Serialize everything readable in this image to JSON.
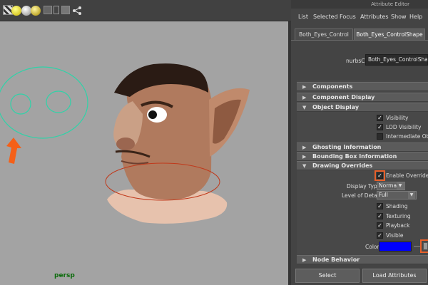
{
  "viewport": {
    "camera_label": "persp",
    "toolbar_icons": [
      "checker-icon",
      "light-yellow-icon",
      "light-gray-icon",
      "light-sphere-icon",
      "lights-icon",
      "isolate-icon",
      "cube-icon",
      "share-icon"
    ]
  },
  "attribute_editor": {
    "window_title": "Attribute Editor",
    "menu": [
      "List",
      "Selected",
      "Focus",
      "Attributes",
      "Show",
      "Help"
    ],
    "tabs": [
      "Both_Eyes_Control",
      "Both_Eyes_ControlShape"
    ],
    "active_tab": 1,
    "nurbs_label": "nurbsCurve:",
    "nurbs_value": "Both_Eyes_ControlShape",
    "sections": {
      "components": "Components",
      "component_display": "Component Display",
      "object_display": "Object Display",
      "ghosting": "Ghosting Information",
      "bounding_box": "Bounding Box Information",
      "drawing_overrides": "Drawing Overrides",
      "node_behavior": "Node Behavior"
    },
    "object_display": {
      "visibility": "Visibility",
      "lod_visibility": "LOD Visibility",
      "intermediate_object": "Intermediate Object"
    },
    "drawing_overrides": {
      "enable_overrides": "Enable Overrides",
      "display_type_label": "Display Type",
      "display_type_value": "Normal",
      "lod_label": "Level of Detail",
      "lod_value": "Full",
      "shading": "Shading",
      "texturing": "Texturing",
      "playback": "Playback",
      "visible": "Visible",
      "color_label": "Color",
      "color_value": "#0000ff"
    },
    "buttons": {
      "select": "Select",
      "load_attributes": "Load Attributes"
    }
  },
  "colors": {
    "highlight": "#e8602a",
    "nurbs_curve": "#2fd3a8",
    "selected_curve": "#c0391b",
    "override_color": "#0000ff"
  }
}
